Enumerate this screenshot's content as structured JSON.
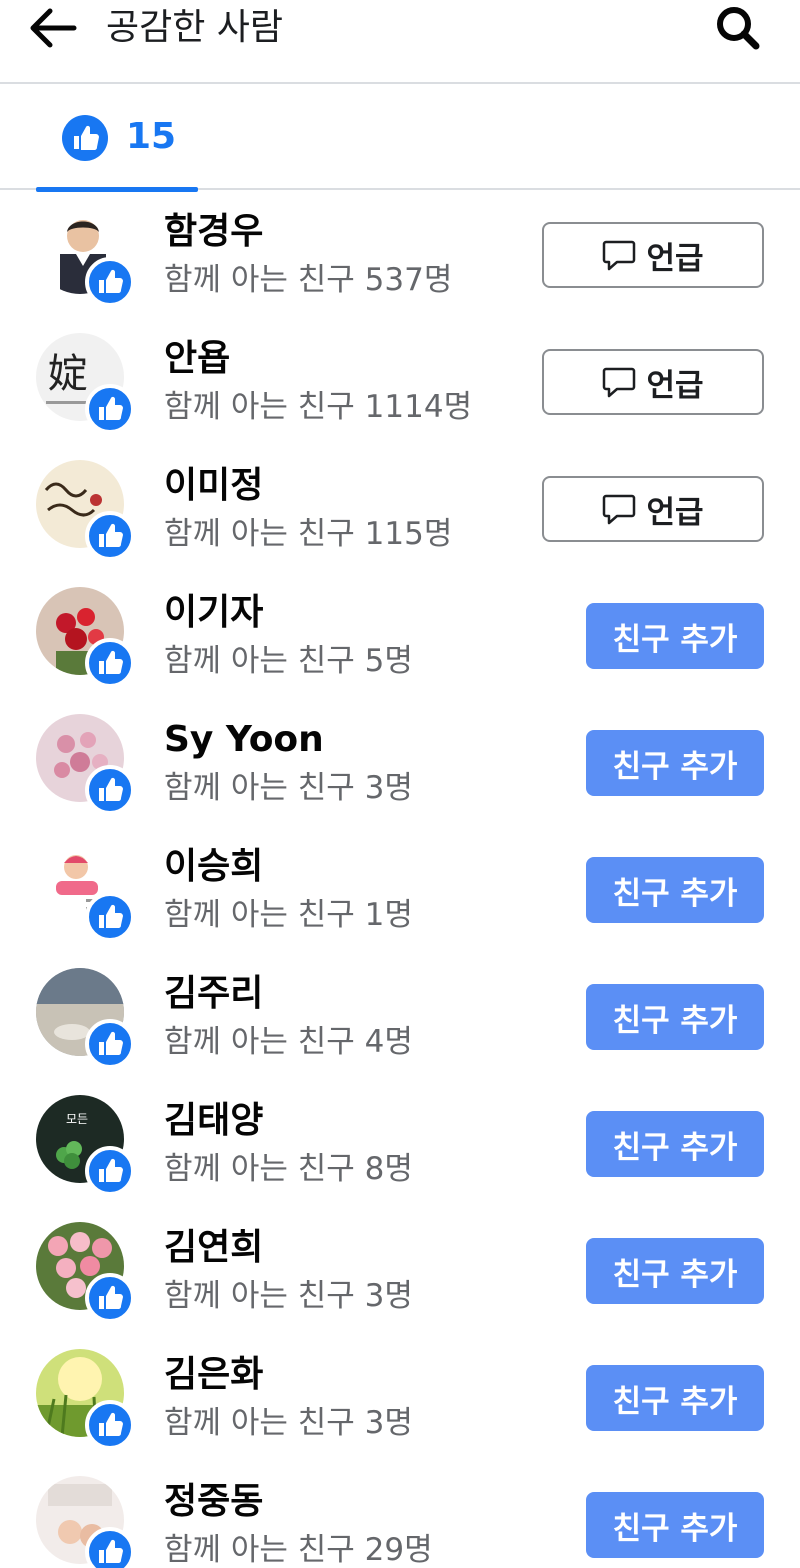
{
  "header": {
    "title": "공감한 사람",
    "back_icon": "arrow-left-icon",
    "search_icon": "search-icon"
  },
  "tabs": [
    {
      "icon": "like-thumb-icon",
      "count": "15",
      "selected": true
    }
  ],
  "colors": {
    "accent": "#1877f2",
    "add_button": "#5b8ff5",
    "secondary_text": "#65676b",
    "divider": "#dadde1"
  },
  "people": [
    {
      "name": "함경우",
      "mutual": "함께 아는 친구 537명",
      "action": "mention",
      "action_label": "언급"
    },
    {
      "name": "안욥",
      "mutual": "함께 아는 친구 1114명",
      "action": "mention",
      "action_label": "언급"
    },
    {
      "name": "이미정",
      "mutual": "함께 아는 친구 115명",
      "action": "mention",
      "action_label": "언급"
    },
    {
      "name": "이기자",
      "mutual": "함께 아는 친구 5명",
      "action": "add",
      "action_label": "친구 추가"
    },
    {
      "name": "Sy Yoon",
      "mutual": "함께 아는 친구 3명",
      "action": "add",
      "action_label": "친구 추가"
    },
    {
      "name": "이승희",
      "mutual": "함께 아는 친구 1명",
      "action": "add",
      "action_label": "친구 추가"
    },
    {
      "name": "김주리",
      "mutual": "함께 아는 친구 4명",
      "action": "add",
      "action_label": "친구 추가"
    },
    {
      "name": "김태양",
      "mutual": "함께 아는 친구 8명",
      "action": "add",
      "action_label": "친구 추가"
    },
    {
      "name": "김연희",
      "mutual": "함께 아는 친구 3명",
      "action": "add",
      "action_label": "친구 추가"
    },
    {
      "name": "김은화",
      "mutual": "함께 아는 친구 3명",
      "action": "add",
      "action_label": "친구 추가"
    },
    {
      "name": "정중동",
      "mutual": "함께 아는 친구 29명",
      "action": "add",
      "action_label": "친구 추가"
    }
  ]
}
